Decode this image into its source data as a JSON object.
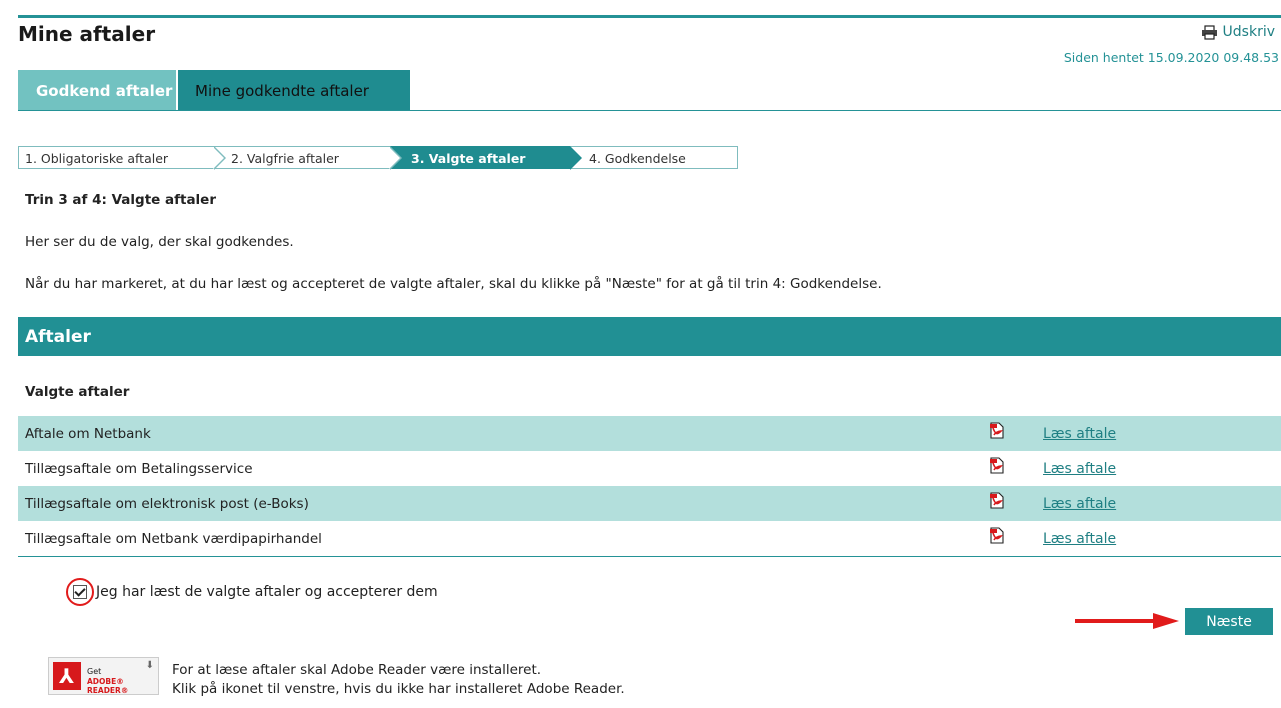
{
  "header": {
    "title": "Mine aftaler",
    "print_label": "Udskriv",
    "retrieved": "Siden hentet 15.09.2020 09.48.53"
  },
  "tabs": [
    {
      "label": "Godkend aftaler",
      "active": true
    },
    {
      "label": "Mine godkendte aftaler",
      "active": false
    }
  ],
  "steps": [
    {
      "label": "1. Obligatoriske aftaler",
      "current": false
    },
    {
      "label": "2. Valgfrie aftaler",
      "current": false
    },
    {
      "label": "3. Valgte aftaler",
      "current": true
    },
    {
      "label": "4. Godkendelse",
      "current": false
    }
  ],
  "intro": {
    "step_heading": "Trin 3 af 4: Valgte aftaler",
    "line1": "Her ser du de valg, der skal godkendes.",
    "line2": "Når du har markeret, at du har læst og accepteret de valgte aftaler, skal du klikke på \"Næste\" for at gå til trin 4: Godkendelse."
  },
  "section": {
    "title": "Aftaler",
    "subtitle": "Valgte aftaler"
  },
  "agreements": [
    {
      "name": "Aftale om Netbank",
      "link": "Læs aftale"
    },
    {
      "name": "Tillægsaftale om Betalingsservice",
      "link": "Læs aftale"
    },
    {
      "name": "Tillægsaftale om elektronisk post (e-Boks)",
      "link": "Læs aftale"
    },
    {
      "name": "Tillægsaftale om Netbank værdipapirhandel",
      "link": "Læs aftale"
    }
  ],
  "accept": {
    "label": "Jeg har læst de valgte aftaler og accepterer dem",
    "checked": true
  },
  "next_label": "Næste",
  "adobe": {
    "badge_get": "Get",
    "badge_reader": "ADOBE® READER®",
    "line1": "For at læse aftaler skal Adobe Reader være installeret.",
    "line2": "Klik på ikonet til venstre, hvis du ikke har installeret Adobe Reader."
  },
  "colors": {
    "accent": "#219094",
    "tab_active": "#72c2c1",
    "row_alt": "#b3dfdc",
    "annotation": "#e11b1b"
  }
}
